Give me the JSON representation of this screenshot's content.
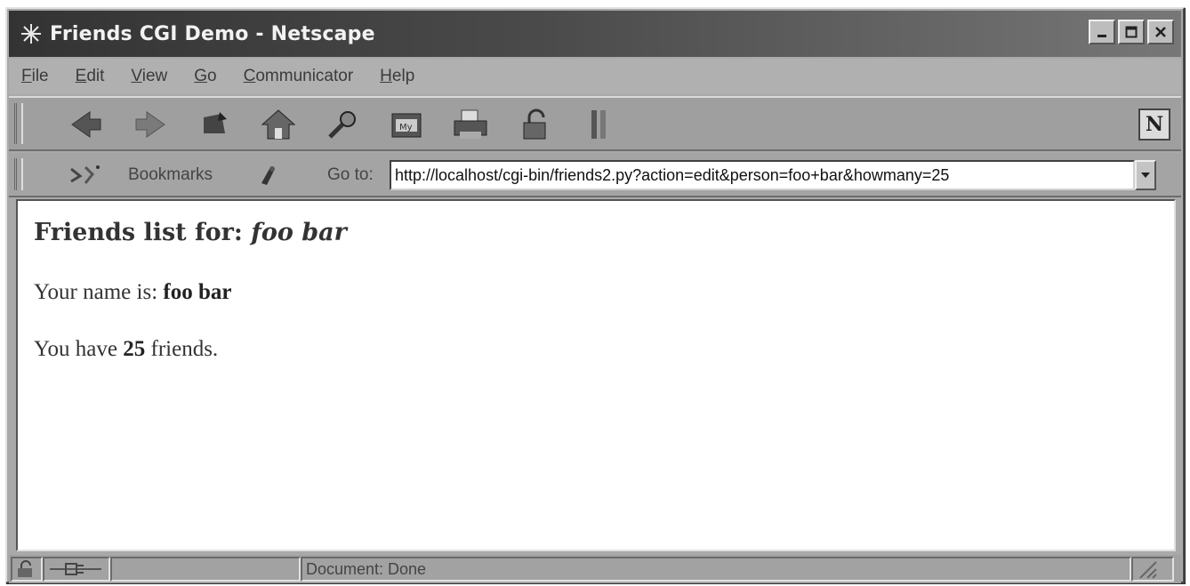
{
  "window": {
    "title": "Friends CGI Demo - Netscape"
  },
  "menubar": {
    "items": [
      {
        "accel": "F",
        "rest": "ile"
      },
      {
        "accel": "E",
        "rest": "dit"
      },
      {
        "accel": "V",
        "rest": "iew"
      },
      {
        "accel": "G",
        "rest": "o"
      },
      {
        "accel": "C",
        "rest": "ommunicator"
      },
      {
        "accel": "H",
        "rest": "elp"
      }
    ]
  },
  "toolbar": {
    "icons": [
      "back-icon",
      "forward-icon",
      "reload-icon",
      "home-icon",
      "search-icon",
      "guide-icon",
      "print-icon",
      "security-icon",
      "stop-icon"
    ],
    "brand": "N"
  },
  "location": {
    "bookmarks_label": "Bookmarks",
    "goto_label": "Go to:",
    "url": "http://localhost/cgi-bin/friends2.py?action=edit&person=foo+bar&howmany=25"
  },
  "content": {
    "heading_prefix": "Friends list for: ",
    "heading_name": "foo bar",
    "name_prefix": "Your name is: ",
    "name_value": "foo bar",
    "friends_prefix": "You have ",
    "friends_count": "25",
    "friends_suffix": " friends."
  },
  "statusbar": {
    "text": "Document: Done"
  },
  "colors": {
    "titlebar": "#3a3a3a",
    "chrome": "#a9a9a9",
    "content_bg": "#ffffff"
  }
}
